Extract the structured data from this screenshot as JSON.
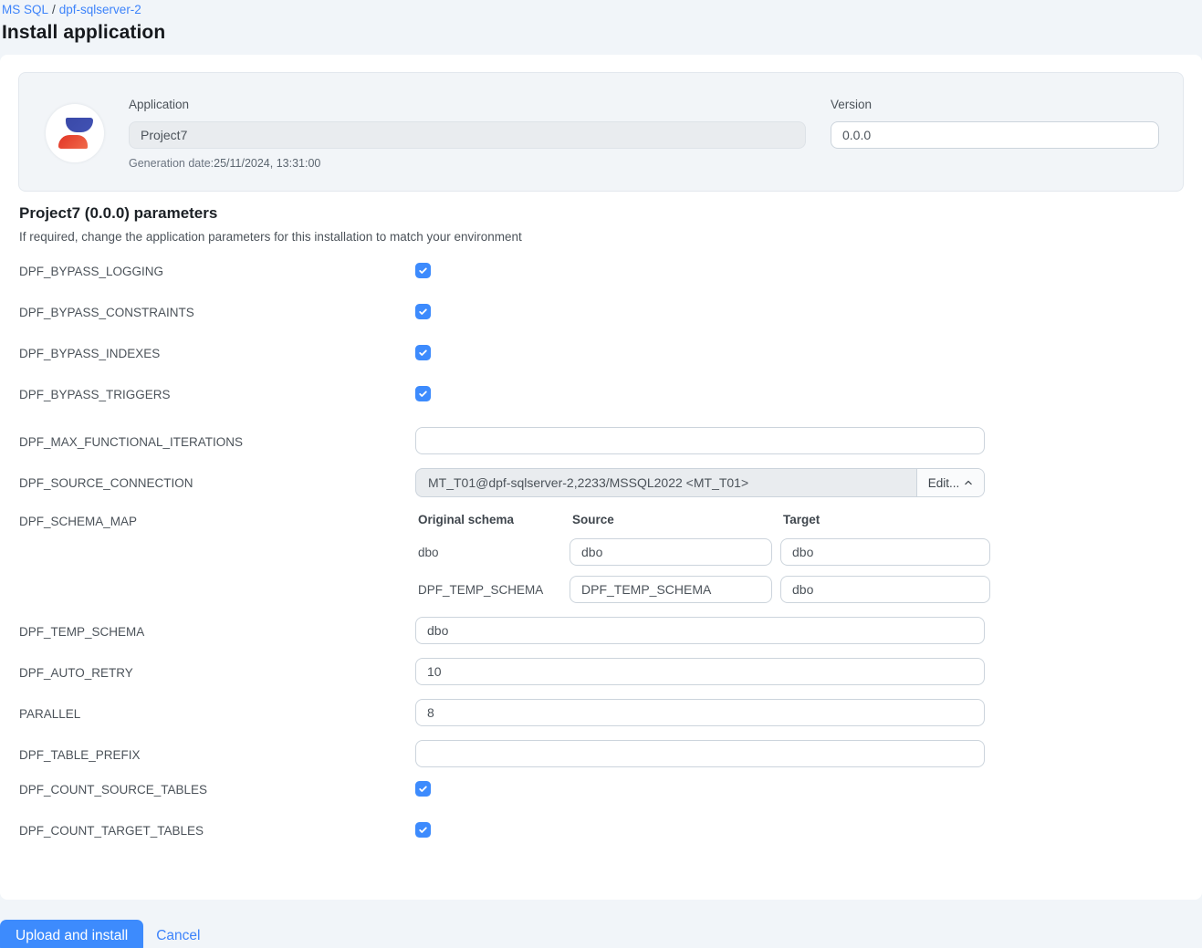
{
  "colors": {
    "accent_blue": "#3d8bfd",
    "link_blue": "#3d83fa",
    "page_background": "#f1f5f9",
    "card_background": "#f2f5f8",
    "disabled_input_background": "#e9ecef",
    "logo_blue": "#3f4aa8",
    "logo_red": "#e8402f"
  },
  "breadcrumb": {
    "root": "MS SQL",
    "separator": "/",
    "current": "dpf-sqlserver-2"
  },
  "page_title": "Install application",
  "app_card": {
    "application_label": "Application",
    "application_value": "Project7",
    "generation_date_label": "Generation date:",
    "generation_date_value": "25/11/2024, 13:31:00",
    "version_label": "Version",
    "version_value": "0.0.0"
  },
  "section": {
    "heading": "Project7 (0.0.0) parameters",
    "subheading": "If required, change the application parameters for this installation to match your environment"
  },
  "parameters": [
    {
      "label": "DPF_BYPASS_LOGGING",
      "type": "checkbox",
      "checked": true
    },
    {
      "label": "DPF_BYPASS_CONSTRAINTS",
      "type": "checkbox",
      "checked": true
    },
    {
      "label": "DPF_BYPASS_INDEXES",
      "type": "checkbox",
      "checked": true
    },
    {
      "label": "DPF_BYPASS_TRIGGERS",
      "type": "checkbox",
      "checked": true
    },
    {
      "label": "DPF_MAX_FUNCTIONAL_ITERATIONS",
      "type": "text",
      "value": ""
    },
    {
      "label": "DPF_SOURCE_CONNECTION",
      "type": "connection",
      "value": "MT_T01@dpf-sqlserver-2,2233/MSSQL2022 <MT_T01>",
      "edit_label": "Edit..."
    },
    {
      "label": "DPF_SCHEMA_MAP",
      "type": "schema-map",
      "headers": [
        "Original schema",
        "Source",
        "Target"
      ],
      "rows": [
        {
          "original": "dbo",
          "source": "dbo",
          "target": "dbo"
        },
        {
          "original": "DPF_TEMP_SCHEMA",
          "source": "DPF_TEMP_SCHEMA",
          "target": "dbo"
        }
      ]
    },
    {
      "label": "DPF_TEMP_SCHEMA",
      "type": "text",
      "value": "dbo"
    },
    {
      "label": "DPF_AUTO_RETRY",
      "type": "text",
      "value": "10"
    },
    {
      "label": "PARALLEL",
      "type": "text",
      "value": "8"
    },
    {
      "label": "DPF_TABLE_PREFIX",
      "type": "text",
      "value": ""
    },
    {
      "label": "DPF_COUNT_SOURCE_TABLES",
      "type": "checkbox",
      "checked": true
    },
    {
      "label": "DPF_COUNT_TARGET_TABLES",
      "type": "checkbox",
      "checked": true
    }
  ],
  "footer": {
    "submit": "Upload and install",
    "cancel": "Cancel"
  }
}
